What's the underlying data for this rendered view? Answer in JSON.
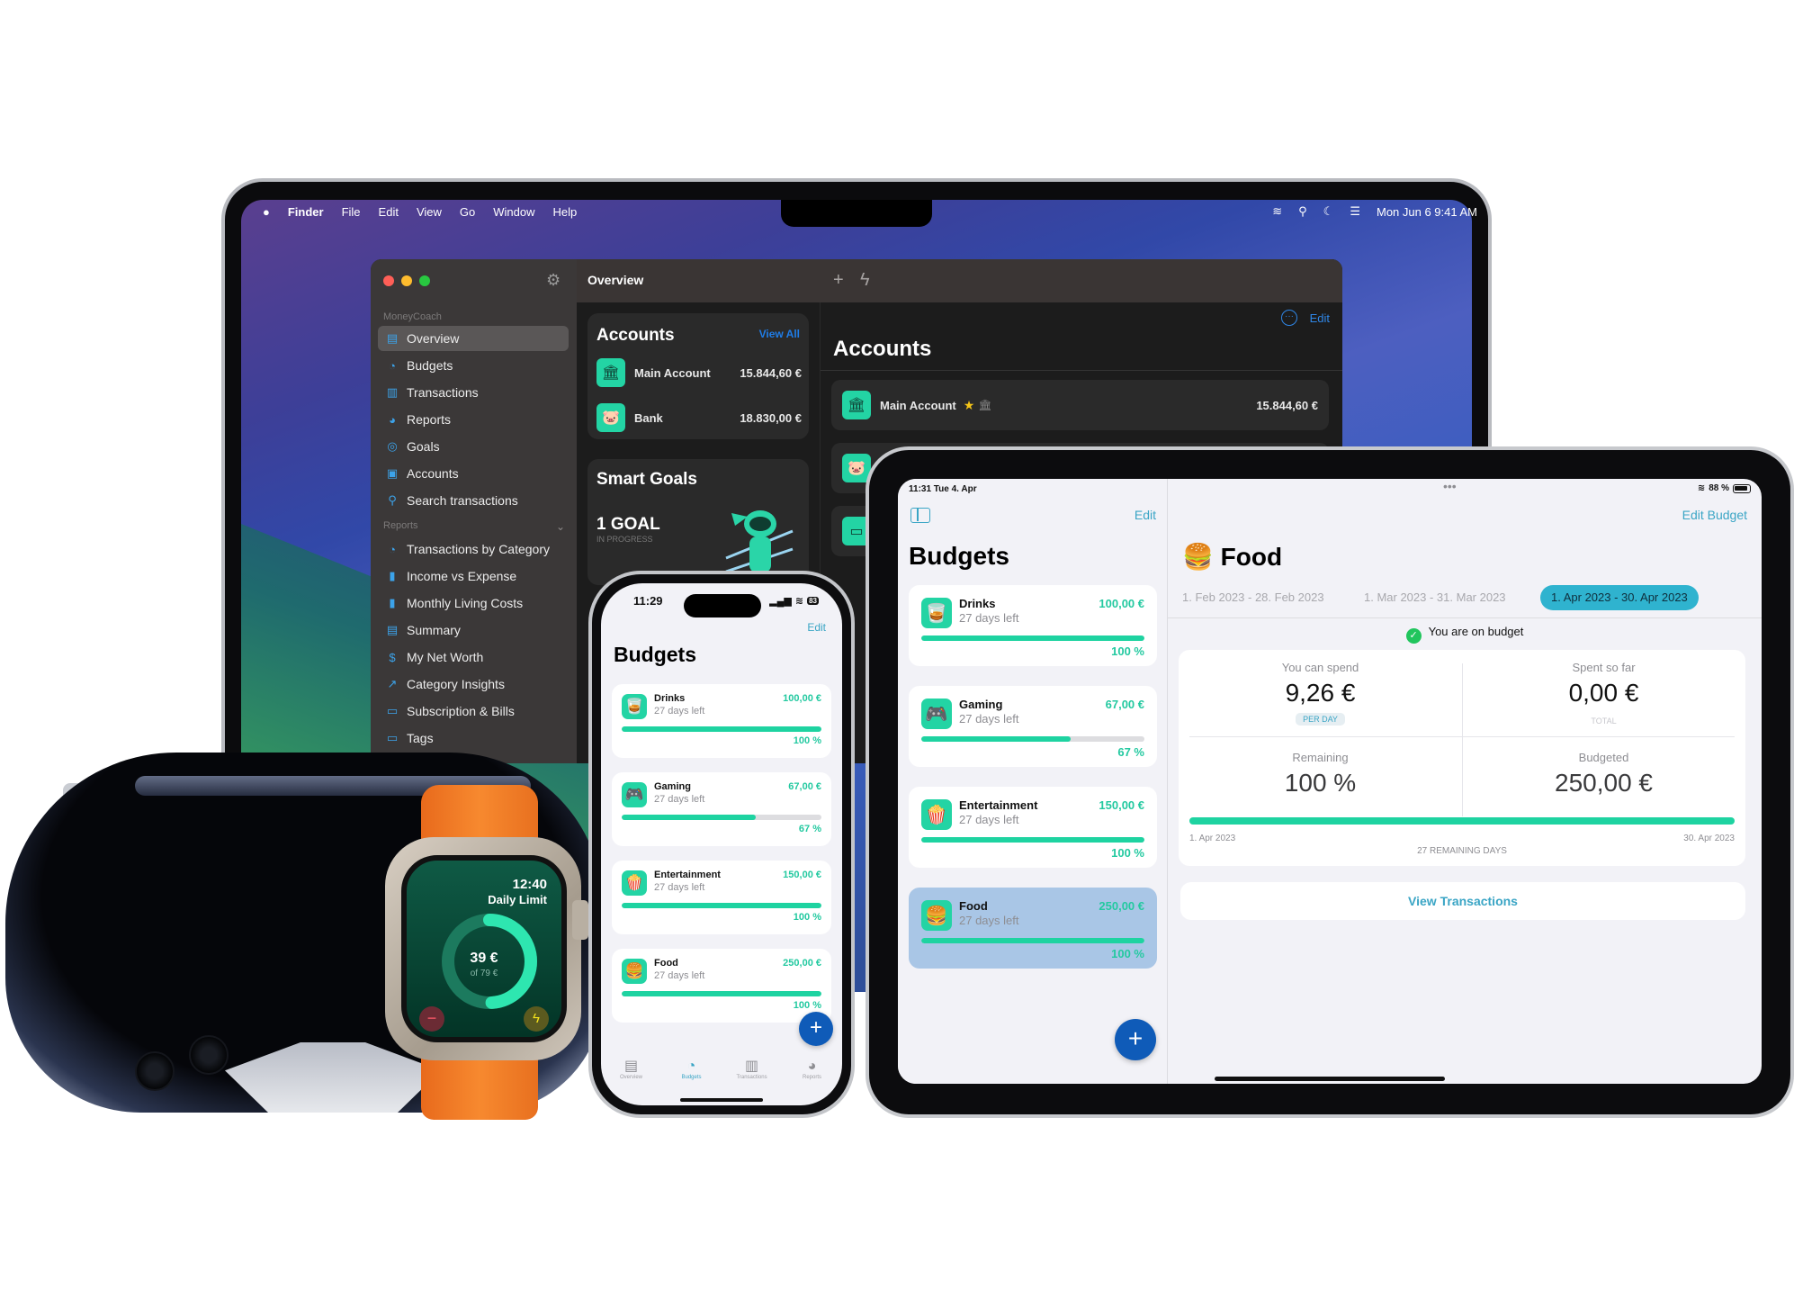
{
  "mac": {
    "menubar": {
      "items": [
        "Finder",
        "File",
        "Edit",
        "View",
        "Go",
        "Window",
        "Help"
      ],
      "datetime": "Mon Jun 6  9:41 AM",
      "status_icons": [
        "wifi-icon",
        "search-icon",
        "moon-icon",
        "control-center-icon"
      ]
    },
    "sidebar": {
      "app_name": "MoneyCoach",
      "items": [
        {
          "label": "Overview",
          "icon": "calendar-icon",
          "glyph": "▤",
          "active": true
        },
        {
          "label": "Budgets",
          "icon": "piggy-bank-icon",
          "glyph": "◔"
        },
        {
          "label": "Transactions",
          "icon": "receipt-icon",
          "glyph": "▥"
        },
        {
          "label": "Reports",
          "icon": "pie-chart-icon",
          "glyph": "◕"
        },
        {
          "label": "Goals",
          "icon": "target-icon",
          "glyph": "◎"
        },
        {
          "label": "Accounts",
          "icon": "accounts-icon",
          "glyph": "▣"
        },
        {
          "label": "Search transactions",
          "icon": "search-icon",
          "glyph": "⚲"
        }
      ],
      "reports_section": "Reports",
      "report_items": [
        {
          "label": "Transactions by Category",
          "icon": "category-chart-icon",
          "glyph": "◔"
        },
        {
          "label": "Income vs Expense",
          "icon": "bar-chart-icon",
          "glyph": "▮"
        },
        {
          "label": "Monthly Living Costs",
          "icon": "bar-chart-icon",
          "glyph": "▮"
        },
        {
          "label": "Summary",
          "icon": "document-icon",
          "glyph": "▤"
        },
        {
          "label": "My Net Worth",
          "icon": "dollar-circle-icon",
          "glyph": "$"
        },
        {
          "label": "Category Insights",
          "icon": "trend-icon",
          "glyph": "↗"
        },
        {
          "label": "Subscription & Bills",
          "icon": "bills-icon",
          "glyph": "▭"
        },
        {
          "label": "Tags",
          "icon": "tag-icon",
          "glyph": "▭"
        }
      ]
    },
    "overview": {
      "title": "Overview",
      "accounts_card": {
        "title": "Accounts",
        "view_all": "View All",
        "rows": [
          {
            "name": "Main Account",
            "value": "15.844,60 €",
            "icon": "bank-icon"
          },
          {
            "name": "Bank",
            "value": "18.830,00 €",
            "icon": "piggy-bank-icon"
          }
        ]
      },
      "goals_card": {
        "title": "Smart Goals",
        "count": "1 GOAL",
        "status": "IN PROGRESS"
      }
    },
    "accounts_panel": {
      "title": "Accounts",
      "edit": "Edit",
      "row": {
        "name": "Main Account",
        "value": "15.844,60 €"
      }
    }
  },
  "ipad": {
    "status_time": "11:31  Tue 4. Apr",
    "battery": "88 %",
    "sidebar": {
      "edit": "Edit",
      "title": "Budgets"
    },
    "detail": {
      "edit_budget": "Edit Budget",
      "title": "🍔 Food",
      "periods": [
        {
          "label": "1. Feb 2023 - 28. Feb 2023",
          "active": false
        },
        {
          "label": "1. Mar 2023 - 31. Mar 2023",
          "active": false
        },
        {
          "label": "1. Apr 2023 - 30. Apr 2023",
          "active": true
        }
      ],
      "status": "You are on budget",
      "stats": {
        "can_spend_label": "You can spend",
        "can_spend_value": "9,26 €",
        "can_spend_sub": "PER DAY",
        "spent_label": "Spent so far",
        "spent_value": "0,00 €",
        "spent_sub": "TOTAL",
        "remaining_label": "Remaining",
        "remaining_value": "100 %",
        "budgeted_label": "Budgeted",
        "budgeted_value": "250,00 €",
        "progress": 1.0,
        "start_date": "1. Apr 2023",
        "end_date": "30. Apr 2023",
        "remaining_days": "27 REMAINING DAYS"
      },
      "view_transactions": "View Transactions"
    }
  },
  "budgets": [
    {
      "name": "Drinks",
      "emoji": "🥃",
      "days_left": "27 days left",
      "amount": "100,00 €",
      "percent_label": "100 %",
      "progress": 1.0
    },
    {
      "name": "Gaming",
      "emoji": "🎮",
      "days_left": "27 days left",
      "amount": "67,00 €",
      "percent_label": "67 %",
      "progress": 0.67
    },
    {
      "name": "Entertainment",
      "emoji": "🍿",
      "days_left": "27 days left",
      "amount": "150,00 €",
      "percent_label": "100 %",
      "progress": 1.0
    },
    {
      "name": "Food",
      "emoji": "🍔",
      "days_left": "27 days left",
      "amount": "250,00 €",
      "percent_label": "100 %",
      "progress": 1.0
    }
  ],
  "iphone": {
    "time": "11:29",
    "battery": "83",
    "edit": "Edit",
    "title": "Budgets",
    "tabs": [
      {
        "label": "Overview",
        "icon": "overview-tab-icon",
        "glyph": "▤",
        "active": false
      },
      {
        "label": "Budgets",
        "icon": "piggy-bank-icon",
        "glyph": "◔",
        "active": true
      },
      {
        "label": "Transactions",
        "icon": "receipt-icon",
        "glyph": "▥",
        "active": false
      },
      {
        "label": "Reports",
        "icon": "pie-chart-icon",
        "glyph": "◕",
        "active": false
      }
    ]
  },
  "watch": {
    "time": "12:40",
    "label": "Daily Limit",
    "value": "39 €",
    "of": "of 79 €",
    "progress": 0.49
  },
  "colors": {
    "accent_green": "#1ed3a1",
    "accent_blue": "#3aa5c5",
    "fab_blue": "#0f5bb8",
    "period_active": "#2fb3cf"
  }
}
